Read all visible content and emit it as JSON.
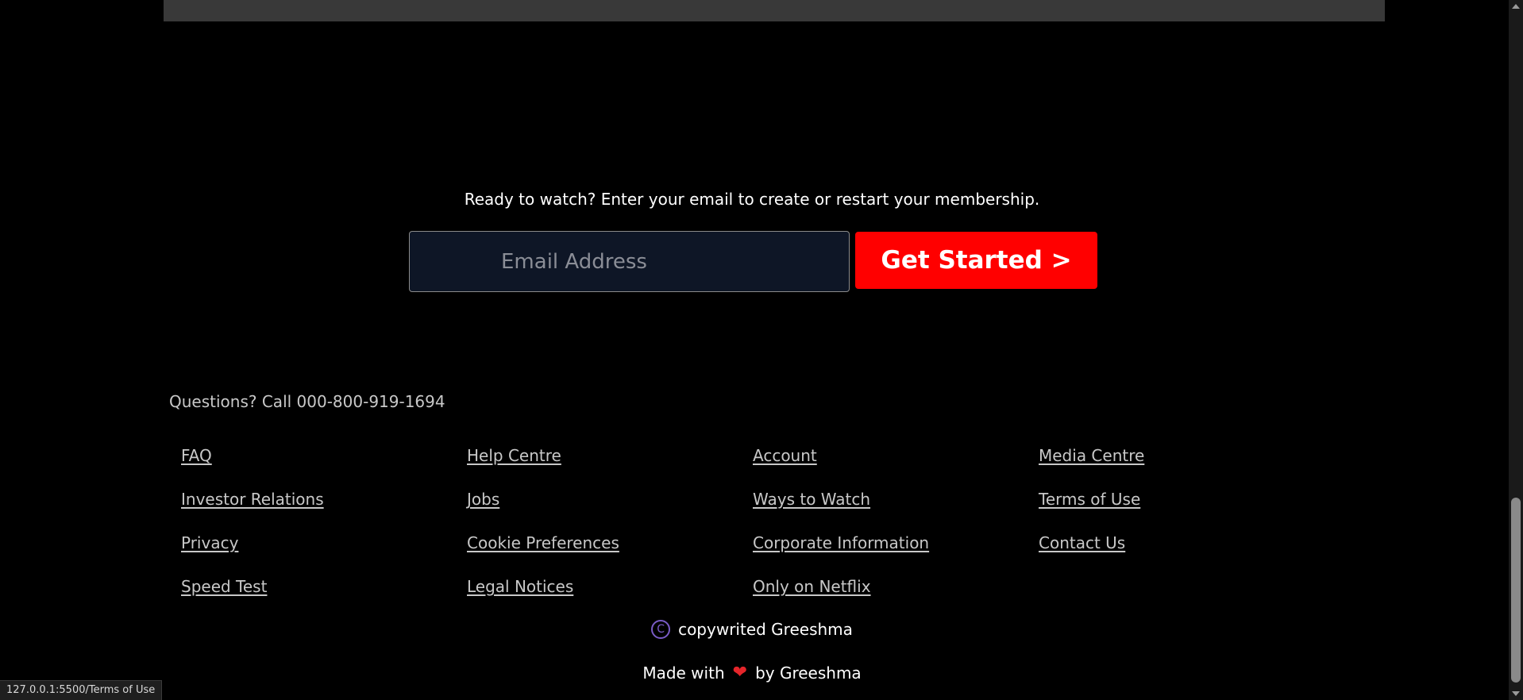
{
  "hero_band": {},
  "cta": {
    "text": "Ready to watch? Enter your email to create or restart your membership.",
    "email_placeholder": "Email Address",
    "button_label": "Get Started >"
  },
  "footer": {
    "questions": "Questions? Call 000-800-919-1694",
    "links": [
      "FAQ",
      "Help Centre",
      "Account",
      "Media Centre",
      "Investor Relations",
      "Jobs",
      "Ways to Watch",
      "Terms of Use",
      "Privacy",
      "Cookie Preferences",
      "Corporate Information",
      "Contact Us",
      "Speed Test",
      "Legal Notices",
      "Only on Netflix"
    ],
    "copyright_symbol": "C",
    "copyright_text": "copywrited Greeshma",
    "made_with_prefix": "Made with",
    "heart_glyph": "❤",
    "made_with_suffix": "by Greeshma"
  },
  "status_bar": {
    "url": "127.0.0.1:5500/Terms of Use"
  },
  "colors": {
    "background": "#000000",
    "accent_red": "#ff0000",
    "input_bg": "#0e1626",
    "link_text": "#c8c8c8",
    "copyright_icon": "#7a5cc7",
    "heart": "#e5252a"
  }
}
